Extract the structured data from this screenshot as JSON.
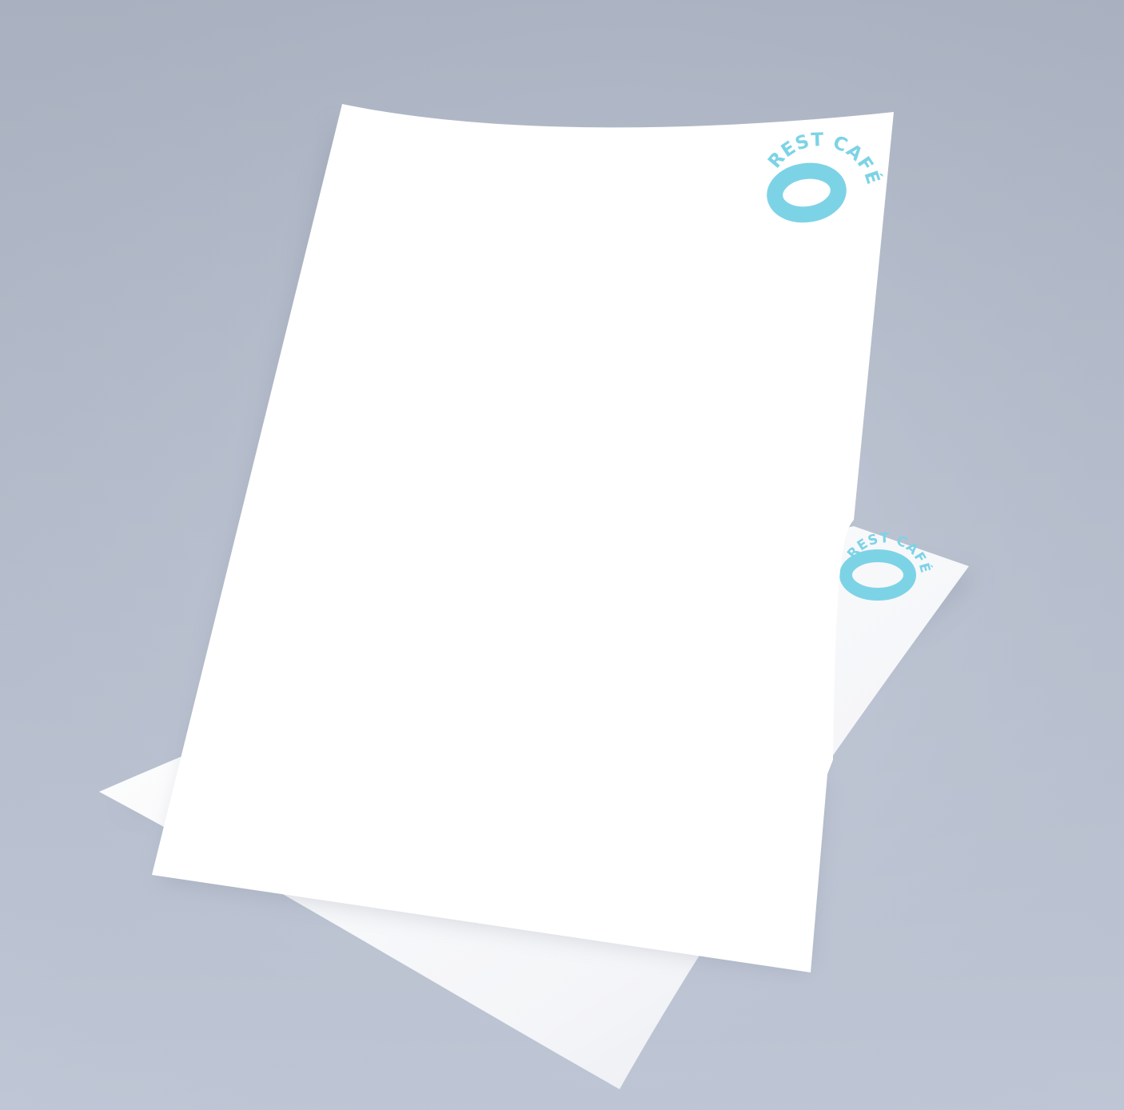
{
  "scene": {
    "description_free": true,
    "colors": {
      "background_top": "#a9b1c0",
      "background_bottom": "#bfc7d6",
      "paper": "#ffffff",
      "paper_shade": "#e9ebf0",
      "brand": "#7dd3e6"
    }
  },
  "logo": {
    "text": "REST CAFÉ",
    "icon": "ring-logo-icon"
  },
  "back_sheet": {
    "logo_text": "REST CAFÉ"
  },
  "front_sheet": {
    "logo_text": "REST CAFÉ"
  }
}
